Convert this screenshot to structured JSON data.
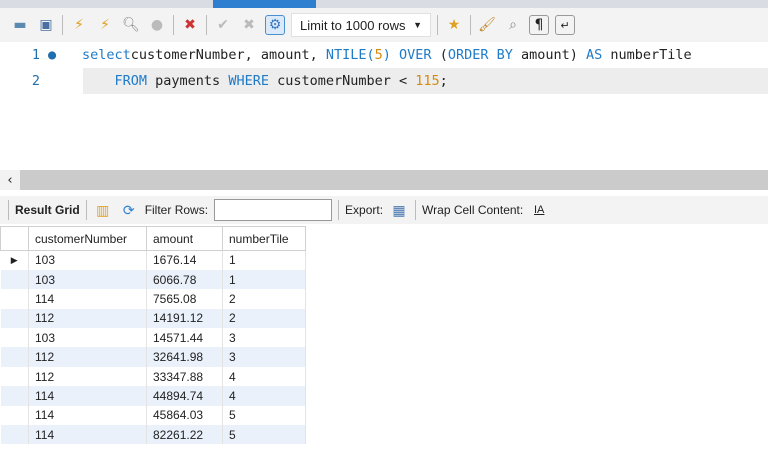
{
  "toolbar": {
    "limit_select": "Limit to 1000 rows"
  },
  "editor": {
    "lines": [
      {
        "number": "1",
        "parts": [
          [
            "kw",
            "select"
          ],
          [
            "",
            "customerNumber, amount, "
          ],
          [
            "kw",
            "NTILE("
          ],
          [
            "num",
            "5"
          ],
          [
            "kw",
            ") OVER"
          ],
          [
            "",
            " ("
          ],
          [
            "kw",
            "ORDER BY"
          ],
          [
            "",
            " amount) "
          ],
          [
            "kw",
            "AS"
          ],
          [
            "",
            " numberTile"
          ]
        ]
      },
      {
        "number": "2",
        "parts": [
          [
            "",
            "    "
          ],
          [
            "kw",
            "FROM"
          ],
          [
            "",
            " payments "
          ],
          [
            "kw",
            "WHERE"
          ],
          [
            "",
            " customerNumber < "
          ],
          [
            "num",
            "115"
          ],
          [
            "",
            ";"
          ]
        ]
      }
    ]
  },
  "results": {
    "result_grid_label": "Result Grid",
    "filter_label": "Filter Rows:",
    "filter_value": "",
    "export_label": "Export:",
    "wrap_label": "Wrap Cell Content:",
    "columns": [
      "customerNumber",
      "amount",
      "numberTile"
    ],
    "rows": [
      [
        "103",
        "1676.14",
        "1"
      ],
      [
        "103",
        "6066.78",
        "1"
      ],
      [
        "114",
        "7565.08",
        "2"
      ],
      [
        "112",
        "14191.12",
        "2"
      ],
      [
        "103",
        "14571.44",
        "3"
      ],
      [
        "112",
        "32641.98",
        "3"
      ],
      [
        "112",
        "33347.88",
        "4"
      ],
      [
        "114",
        "44894.74",
        "4"
      ],
      [
        "114",
        "45864.03",
        "5"
      ],
      [
        "114",
        "82261.22",
        "5"
      ]
    ]
  }
}
